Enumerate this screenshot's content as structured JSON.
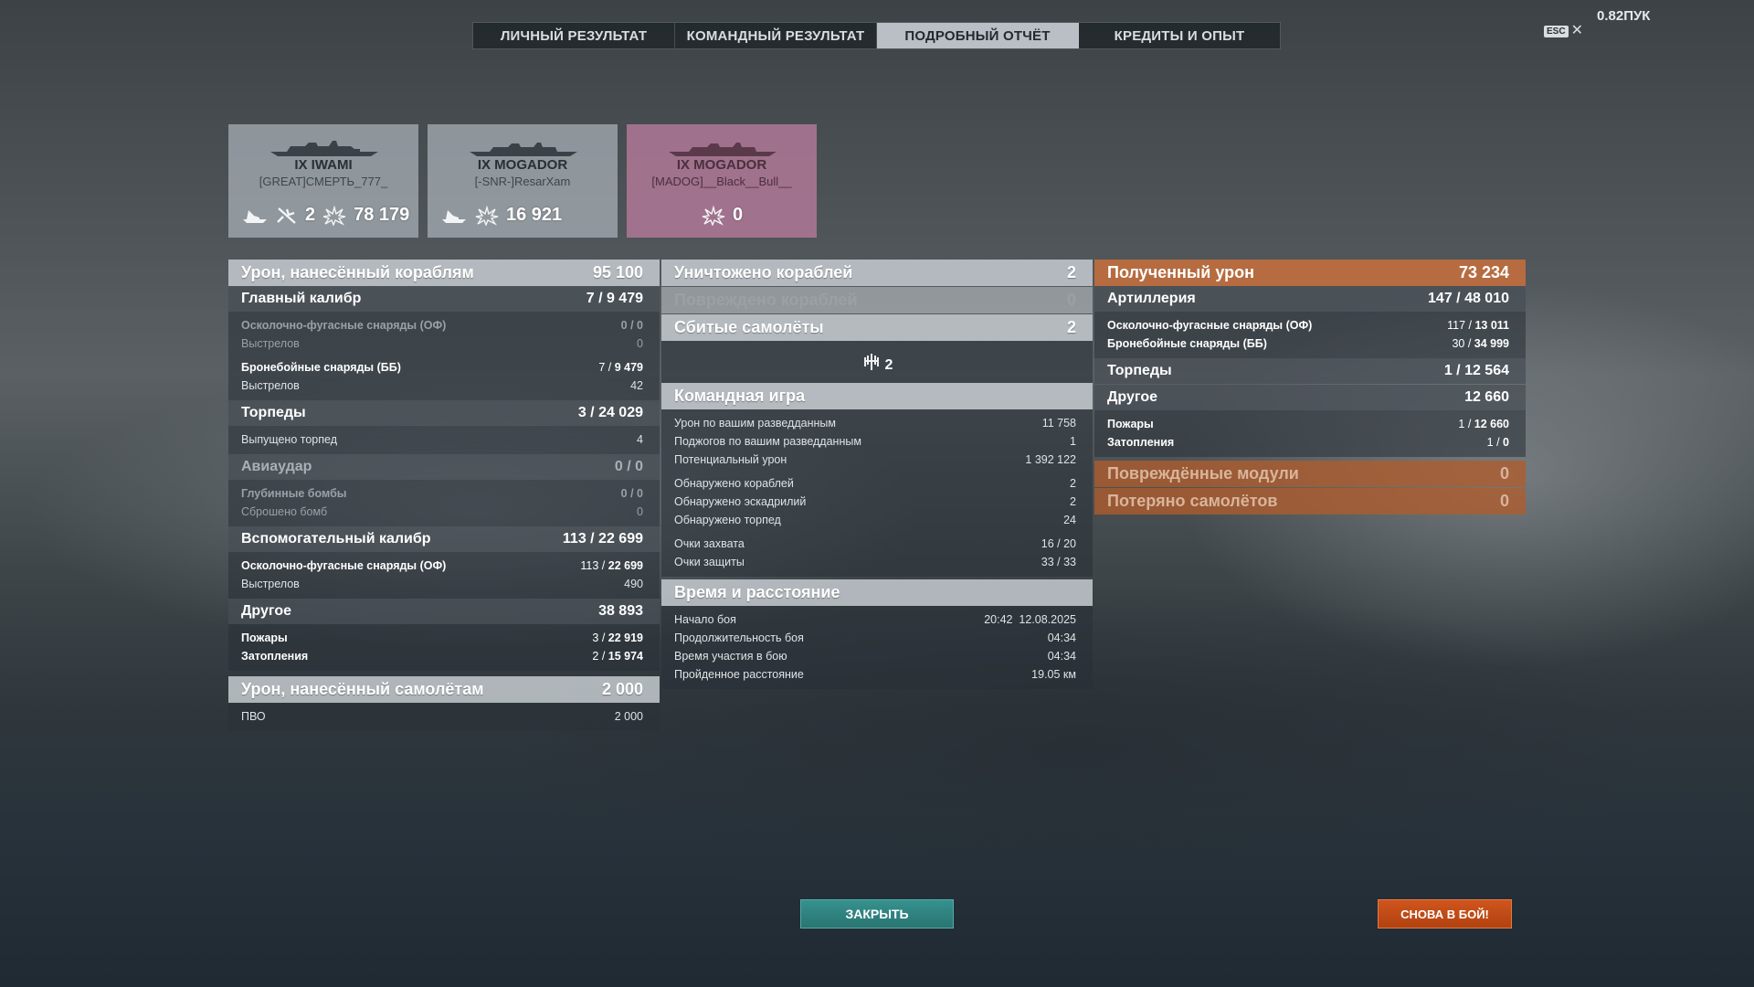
{
  "tabs": [
    {
      "label": "ЛИЧНЫЙ РЕЗУЛЬТАТ"
    },
    {
      "label": "КОМАНДНЫЙ РЕЗУЛЬТАТ"
    },
    {
      "label": "ПОДРОБНЫЙ ОТЧЁТ"
    },
    {
      "label": "КРЕДИТЫ И ОПЫТ"
    }
  ],
  "esc": {
    "key": "ESC",
    "close": "✕"
  },
  "version": "0.82ПУК",
  "cards": [
    {
      "name": "IX IWAMI",
      "nick": "[GREAT]СМЕРТЬ_777_",
      "kills": "2",
      "damage": "78 179"
    },
    {
      "name": "IX MOGADOR",
      "nick": "[-SNR-]ResarXam",
      "damage": "16 921"
    },
    {
      "name": "IX MOGADOR",
      "nick": "[MADOG]__Black__Bull__",
      "damage": "0"
    }
  ],
  "left": {
    "dmg_header": {
      "label": "Урон, нанесённый кораблям",
      "value": "95 100"
    },
    "main_caliber": {
      "label": "Главный калибр",
      "value": "7 / 9 479"
    },
    "he": {
      "label": "Осколочно-фугасные снаряды (ОФ)",
      "value": "0 / 0"
    },
    "he_shots": {
      "label": "Выстрелов",
      "value": "0"
    },
    "ap": {
      "label": "Бронебойные снаряды (ББ)",
      "hits": "7 / ",
      "dmg": "9 479"
    },
    "ap_shots": {
      "label": "Выстрелов",
      "value": "42"
    },
    "torps": {
      "label": "Торпеды",
      "value": "3 / 24 029"
    },
    "torps_fired": {
      "label": "Выпущено торпед",
      "value": "4"
    },
    "air": {
      "label": "Авиаудар",
      "value": "0 / 0"
    },
    "depth": {
      "label": "Глубинные бомбы",
      "value": "0 / 0"
    },
    "bombs": {
      "label": "Сброшено бомб",
      "value": "0"
    },
    "secondary": {
      "label": "Вспомогательный калибр",
      "value": "113 / 22 699"
    },
    "sec_he": {
      "label": "Осколочно-фугасные снаряды (ОФ)",
      "hits": "113 / ",
      "dmg": "22 699"
    },
    "sec_shots": {
      "label": "Выстрелов",
      "value": "490"
    },
    "other": {
      "label": "Другое",
      "value": "38 893"
    },
    "fires": {
      "label": "Пожары",
      "hits": "3 / ",
      "dmg": "22 919"
    },
    "floods": {
      "label": "Затопления",
      "hits": "2 / ",
      "dmg": "15 974"
    },
    "plane_dmg": {
      "label": "Урон, нанесённый самолётам",
      "value": "2 000"
    },
    "aa": {
      "label": "ПВО",
      "value": "2 000"
    }
  },
  "mid": {
    "destroyed": {
      "label": "Уничтожено кораблей",
      "value": "2"
    },
    "damaged": {
      "label": "Повреждено кораблей",
      "value": "0"
    },
    "planes": {
      "label": "Сбитые самолёты",
      "value": "2",
      "icon_count": "2"
    },
    "team": {
      "label": "Командная игра"
    },
    "spot_dmg": {
      "label": "Урон по вашим разведданным",
      "value": "11 758"
    },
    "spot_fires": {
      "label": "Поджогов по вашим разведданным",
      "value": "1"
    },
    "potential": {
      "label": "Потенциальный урон",
      "value": "1 392 122"
    },
    "det_ships": {
      "label": "Обнаружено кораблей",
      "value": "2"
    },
    "det_squads": {
      "label": "Обнаружено эскадрилий",
      "value": "2"
    },
    "det_torps": {
      "label": "Обнаружено торпед",
      "value": "24"
    },
    "capture": {
      "label": "Очки захвата",
      "value": "16 / 20"
    },
    "defense": {
      "label": "Очки защиты",
      "value": "33 / 33"
    },
    "time": {
      "label": "Время и расстояние"
    },
    "start": {
      "label": "Начало боя",
      "value": "20:42  12.08.2025"
    },
    "duration": {
      "label": "Продолжительность боя",
      "value": "04:34"
    },
    "participation": {
      "label": "Время участия в бою",
      "value": "04:34"
    },
    "distance": {
      "label": "Пройденное расстояние",
      "value": "19.05 км"
    }
  },
  "right": {
    "received": {
      "label": "Полученный урон",
      "value": "73 234"
    },
    "artillery": {
      "label": "Артиллерия",
      "value": "147 / 48 010"
    },
    "he": {
      "label": "Осколочно-фугасные снаряды (ОФ)",
      "hits": "117 / ",
      "dmg": "13 011"
    },
    "ap": {
      "label": "Бронебойные снаряды (ББ)",
      "hits": "30 / ",
      "dmg": "34 999"
    },
    "torps": {
      "label": "Торпеды",
      "value": "1 / 12 564"
    },
    "other": {
      "label": "Другое",
      "value": "12 660"
    },
    "fires": {
      "label": "Пожары",
      "hits": "1 / ",
      "dmg": "12 660"
    },
    "floods": {
      "label": "Затопления",
      "hits": "1 / ",
      "dmg": "0"
    },
    "modules": {
      "label": "Повреждённые модули",
      "value": "0"
    },
    "planes_lost": {
      "label": "Потеряно самолётов",
      "value": "0"
    }
  },
  "buttons": {
    "close": "ЗАКРЫТЬ",
    "again": "СНОВА В БОЙ!"
  },
  "colors": {
    "accent_teal": "#2f8480",
    "accent_orange": "#c44c16",
    "received_header": "#c46e3c",
    "enemy_card": "#b07896"
  }
}
